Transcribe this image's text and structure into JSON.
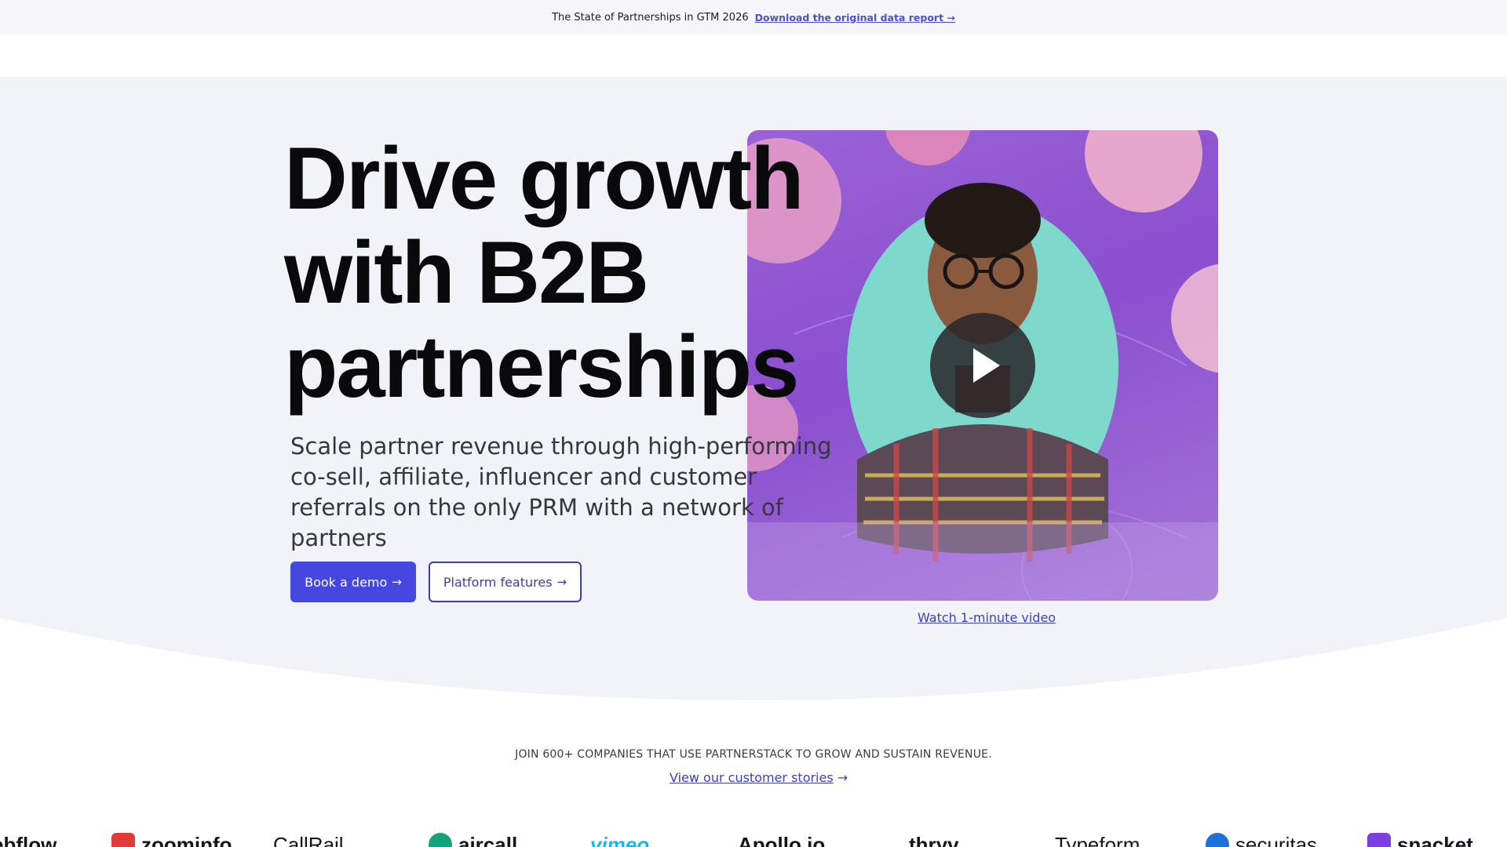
{
  "announcement": {
    "text": "The State of Partnerships in GTM 2026",
    "link_label": "Download the original data report →"
  },
  "hero": {
    "headline_line1": "Drive growth",
    "headline_line2": "with B2B",
    "headline_line3": "partnerships",
    "subheadline": "Scale partner revenue through high-performing co-sell, affiliate, influencer and customer referrals on the only PRM with a network of partners",
    "primary_button": "Book a demo",
    "secondary_button": "Platform features",
    "arrow": "→",
    "video_link": "Watch 1-minute video"
  },
  "social_proof": {
    "join_text": "JOIN 600+ COMPANIES THAT USE PARTNERSTACK TO GROW AND SUSTAIN REVENUE.",
    "stories_link": "View our customer stories",
    "stories_arrow": "→",
    "logos": [
      "ebflow",
      "zoominfo",
      "CallRail",
      "aircall",
      "vimeo",
      "Apollo.io",
      "thryv",
      "Typeform",
      "securitas",
      "snacket"
    ]
  },
  "colors": {
    "accent": "#4548e0",
    "hero_bg": "#f2f2f9",
    "video_purple": "#9b63d6",
    "link": "#3f42b8"
  }
}
